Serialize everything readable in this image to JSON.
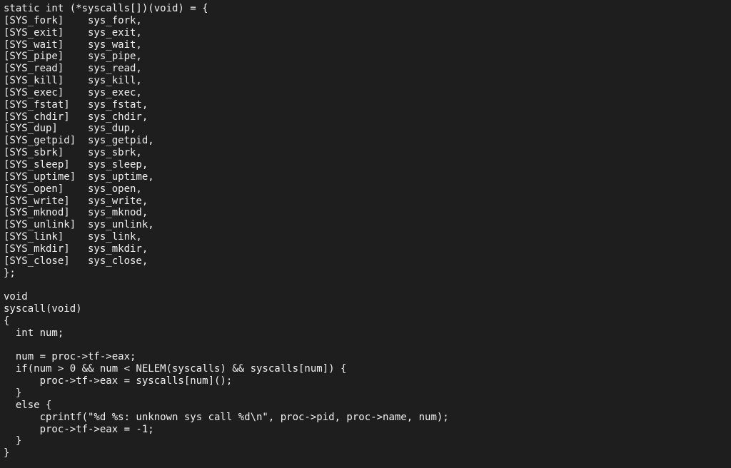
{
  "editor": {
    "background": "#1e1e1e",
    "foreground": "#f0f0f0",
    "lines": [
      "static int (*syscalls[])(void) = {",
      "[SYS_fork]    sys_fork,",
      "[SYS_exit]    sys_exit,",
      "[SYS_wait]    sys_wait,",
      "[SYS_pipe]    sys_pipe,",
      "[SYS_read]    sys_read,",
      "[SYS_kill]    sys_kill,",
      "[SYS_exec]    sys_exec,",
      "[SYS_fstat]   sys_fstat,",
      "[SYS_chdir]   sys_chdir,",
      "[SYS_dup]     sys_dup,",
      "[SYS_getpid]  sys_getpid,",
      "[SYS_sbrk]    sys_sbrk,",
      "[SYS_sleep]   sys_sleep,",
      "[SYS_uptime]  sys_uptime,",
      "[SYS_open]    sys_open,",
      "[SYS_write]   sys_write,",
      "[SYS_mknod]   sys_mknod,",
      "[SYS_unlink]  sys_unlink,",
      "[SYS_link]    sys_link,",
      "[SYS_mkdir]   sys_mkdir,",
      "[SYS_close]   sys_close,",
      "};",
      "",
      "void",
      "syscall(void)",
      "{",
      "  int num;",
      "",
      "  num = proc->tf->eax;",
      "  if(num > 0 && num < NELEM(syscalls) && syscalls[num]) {",
      "      proc->tf->eax = syscalls[num]();",
      "  }",
      "  else {",
      "      cprintf(\"%d %s: unknown sys call %d\\n\", proc->pid, proc->name, num);",
      "      proc->tf->eax = -1;",
      "  }",
      "}"
    ]
  }
}
